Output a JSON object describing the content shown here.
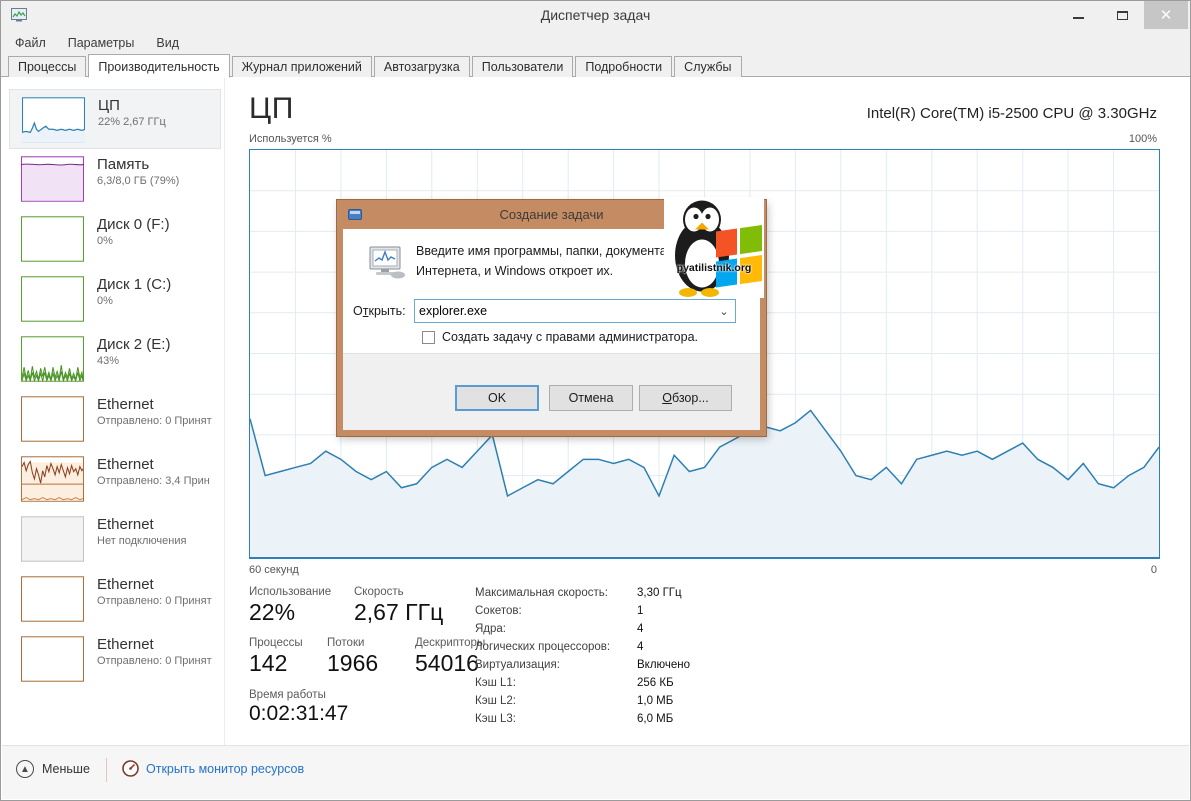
{
  "window": {
    "title": "Диспетчер задач"
  },
  "menu": {
    "items": [
      {
        "label": "Файл"
      },
      {
        "label": "Параметры"
      },
      {
        "label": "Вид"
      }
    ]
  },
  "tabs": {
    "items": [
      {
        "label": "Процессы"
      },
      {
        "label": "Производительность",
        "active": true
      },
      {
        "label": "Журнал приложений"
      },
      {
        "label": "Автозагрузка"
      },
      {
        "label": "Пользователи"
      },
      {
        "label": "Подробности"
      },
      {
        "label": "Службы"
      }
    ]
  },
  "sidebar": {
    "items": [
      {
        "title": "ЦП",
        "subtitle": "22% 2,67 ГГц"
      },
      {
        "title": "Память",
        "subtitle": "6,3/8,0 ГБ (79%)"
      },
      {
        "title": "Диск 0 (F:)",
        "subtitle": "0%"
      },
      {
        "title": "Диск 1 (C:)",
        "subtitle": "0%"
      },
      {
        "title": "Диск 2 (E:)",
        "subtitle": "43%"
      },
      {
        "title": "Ethernet",
        "subtitle": "Отправлено: 0 Принят"
      },
      {
        "title": "Ethernet",
        "subtitle": "Отправлено: 3,4 Прин"
      },
      {
        "title": "Ethernet",
        "subtitle": "Нет подключения"
      },
      {
        "title": "Ethernet",
        "subtitle": "Отправлено: 0 Принят"
      },
      {
        "title": "Ethernet",
        "subtitle": "Отправлено: 0 Принят"
      }
    ]
  },
  "main": {
    "title": "ЦП",
    "cpu_name": "Intel(R) Core(TM) i5-2500 CPU @ 3.30GHz",
    "y_axis_label": "Используется %",
    "y_max_label": "100%",
    "x_left_label": "60 секунд",
    "x_right_label": "0",
    "stats_big": [
      {
        "label": "Использование",
        "value": "22%"
      },
      {
        "label": "Скорость",
        "value": "2,67 ГГц"
      },
      {
        "label": "Процессы",
        "value": "142"
      },
      {
        "label": "Потоки",
        "value": "1966"
      },
      {
        "label": "Дескрипторы",
        "value": "54016"
      },
      {
        "label": "Время работы",
        "value": "0:02:31:47"
      }
    ],
    "details": [
      {
        "label": "Максимальная скорость:",
        "value": "3,30 ГГц"
      },
      {
        "label": "Сокетов:",
        "value": "1"
      },
      {
        "label": "Ядра:",
        "value": "4"
      },
      {
        "label": "Логических процессоров:",
        "value": "4"
      },
      {
        "label": "Виртуализация:",
        "value": "Включено"
      },
      {
        "label": "Кэш L1:",
        "value": "256 КБ"
      },
      {
        "label": "Кэш L2:",
        "value": "1,0 МБ"
      },
      {
        "label": "Кэш L3:",
        "value": "6,0 МБ"
      }
    ]
  },
  "footer": {
    "less_label": "Меньше",
    "resource_monitor_label": "Открыть монитор ресурсов"
  },
  "dialog": {
    "title": "Создание задачи",
    "message_line1": "Введите имя программы, папки, документа и",
    "message_line2": "Интернета, и Windows откроет их.",
    "open_label": {
      "pre": "О",
      "key": "т",
      "post": "крыть:"
    },
    "input_value": "explorer.exe",
    "checkbox_label": "Создать задачу с правами администратора.",
    "buttons": {
      "ok": "OK",
      "cancel": "Отмена",
      "browse": {
        "pre": "",
        "key": "О",
        "post": "бзор..."
      }
    },
    "watermark_text": "pyatilistnik.org"
  },
  "colors": {
    "cpu_accent": "#2d7fb2",
    "cpu_fill": "#ebf3f9",
    "grid": "#e2ebf2",
    "memory_accent": "#a13fb5",
    "disk_accent": "#5a9e32",
    "ethernet_accent": "#a9713c",
    "dialog_titlebar": "#c58c64",
    "link_blue": "#2573c9"
  },
  "chart_data": {
    "type": "area",
    "title": "ЦП — Используется %",
    "ylabel": "Используется %",
    "xlabel": "секунды (60 → 0)",
    "ylim": [
      0,
      100
    ],
    "x_range_seconds": [
      60,
      0
    ],
    "grid": true,
    "values": [
      34,
      20,
      21,
      22,
      23,
      26,
      24,
      21,
      19,
      21,
      17,
      18,
      22,
      24,
      22,
      26,
      30,
      15,
      17,
      19,
      18,
      21,
      24,
      24,
      23,
      24,
      22,
      15,
      25,
      21,
      22,
      27,
      29,
      31,
      32,
      31,
      33,
      36,
      31,
      26,
      20,
      19,
      22,
      18,
      24,
      25,
      26,
      25,
      26,
      24,
      26,
      28,
      24,
      22,
      19,
      23,
      18,
      17,
      20,
      22,
      27
    ]
  }
}
